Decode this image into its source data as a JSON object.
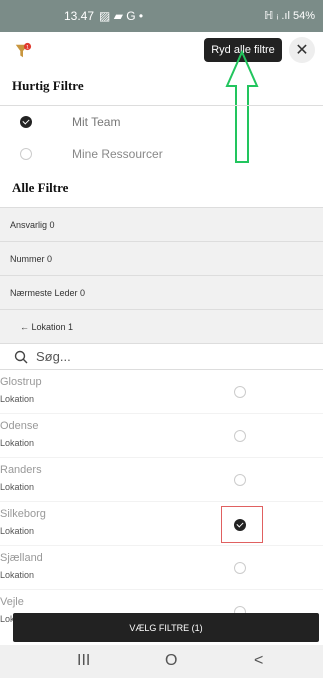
{
  "status_bar": {
    "time": "13.47",
    "left_icons": "▨ ▰ G •",
    "right_text": "ℍ ᵢ .ıl 54%"
  },
  "toolbar": {
    "clear_label": "Ryd alle filtre",
    "close_symbol": "✕"
  },
  "quick_filters": {
    "title": "Hurtig Filtre",
    "items": [
      {
        "label": "Mit Team",
        "checked": true
      },
      {
        "label": "Mine Ressourcer",
        "checked": false
      }
    ]
  },
  "all_filters": {
    "title": "Alle Filtre",
    "items": [
      {
        "label": "Ansvarlig 0"
      },
      {
        "label": "Nummer 0"
      },
      {
        "label": "Nærmeste Leder 0"
      }
    ],
    "location_header": "←  Lokation 1",
    "search_placeholder": "Søg..."
  },
  "locations": [
    {
      "name": "Glostrup",
      "type": "Lokation",
      "checked": false
    },
    {
      "name": "Odense",
      "type": "Lokation",
      "checked": false
    },
    {
      "name": "Randers",
      "type": "Lokation",
      "checked": false
    },
    {
      "name": "Silkeborg",
      "type": "Lokation",
      "checked": true
    },
    {
      "name": "Sjælland",
      "type": "Lokation",
      "checked": false
    },
    {
      "name": "Vejle",
      "type": "Lokation",
      "checked": false
    }
  ],
  "apply_button": {
    "label": "VÆLG FILTRE (1)"
  },
  "nav": {
    "recents": "III",
    "home": "O",
    "back": "<"
  }
}
